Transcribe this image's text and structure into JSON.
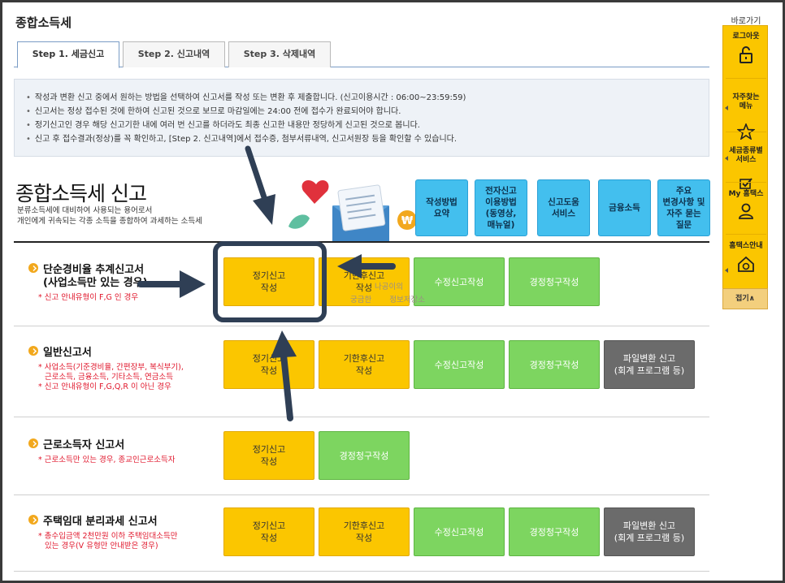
{
  "page": {
    "title": "종합소득세"
  },
  "tabs": [
    {
      "label": "Step 1. 세금신고"
    },
    {
      "label": "Step 2. 신고내역"
    },
    {
      "label": "Step 3. 삭제내역"
    }
  ],
  "notice": [
    "작성과 변환 신고 중에서 원하는 방법을 선택하여 신고서를 작성 또는 변환 후 제출합니다. (신고이용시간 : 06:00~23:59:59)",
    "신고서는 정상 접수된 것에 한하여 신고된 것으로 보므로 마감일에는 24:00 전에 접수가 완료되어야 합니다.",
    "정기신고인 경우 해당 신고기한 내에 여러 번 신고를 하더라도 최종 신고한 내용만 정당하게 신고된 것으로 봅니다.",
    "신고 후 접수결과(정상)를 꼭 확인하고, [Step 2. 신고내역]에서 접수증, 첨부서류내역, 신고서원장 등을 확인할 수 있습니다."
  ],
  "hero": {
    "title": "종합소득세 신고",
    "subtitle_1": "분류소득세에 대비하여 사용되는 용어로서",
    "subtitle_2": "개인에게 귀속되는 각종 소득을 종합하여 과세하는 소득세"
  },
  "quick_buttons": [
    "작성방법\n요약",
    "전자신고\n이용방법\n(동영상,\n매뉴얼)",
    "신고도움\n서비스",
    "금융소득",
    "주요\n변경사항 및\n자주 묻는\n질문"
  ],
  "watermark": {
    "line1": "나공이의",
    "line2": "궁금한",
    "line3": "정보저장소"
  },
  "sections": [
    {
      "title": "단순경비율 추계신고서",
      "title2": "(사업소득만 있는 경우)",
      "notes": [
        "* 신고 안내유형이 F,G 인 경우"
      ],
      "buttons": [
        "정기신고\n작성",
        "기한후신고\n작성",
        "수정신고작성",
        "경정청구작성"
      ]
    },
    {
      "title": "일반신고서",
      "notes": [
        "* 사업소득(기준경비율, 간편장부, 복식부기),",
        "근로소득, 금융소득, 기타소득, 연금소득",
        "* 신고 안내유형이 F,G,Q,R 이 아닌 경우"
      ],
      "buttons": [
        "정기신고\n작성",
        "기한후신고\n작성",
        "수정신고작성",
        "경정청구작성",
        "파일변환 신고\n(회계 프로그램 등)"
      ]
    },
    {
      "title": "근로소득자 신고서",
      "notes": [
        "* 근로소득만 있는 경우, 종교인근로소득자"
      ],
      "buttons": [
        "정기신고\n작성",
        "경정청구작성"
      ]
    },
    {
      "title": "주택임대 분리과세 신고서",
      "notes": [
        "* 총수입금액 2천만원 이하 주택임대소득만",
        "있는 경우(V 유형만 안내받은 경우)"
      ],
      "buttons": [
        "정기신고\n작성",
        "기한후신고\n작성",
        "수정신고작성",
        "경정청구작성",
        "파일변환 신고\n(회계 프로그램 등)"
      ]
    }
  ],
  "sidebar": {
    "title": "바로가기",
    "items": [
      "로그아웃",
      "자주찾는\n메뉴",
      "세금종류별\n서비스",
      "My 홈택스",
      "홈택스안내"
    ],
    "fold": "접기∧"
  },
  "colors": {
    "yellow": "#fbc600",
    "green": "#7dd560",
    "gray": "#6b6b6b",
    "blue": "#43bfee",
    "arrow": "#2f3f55"
  }
}
